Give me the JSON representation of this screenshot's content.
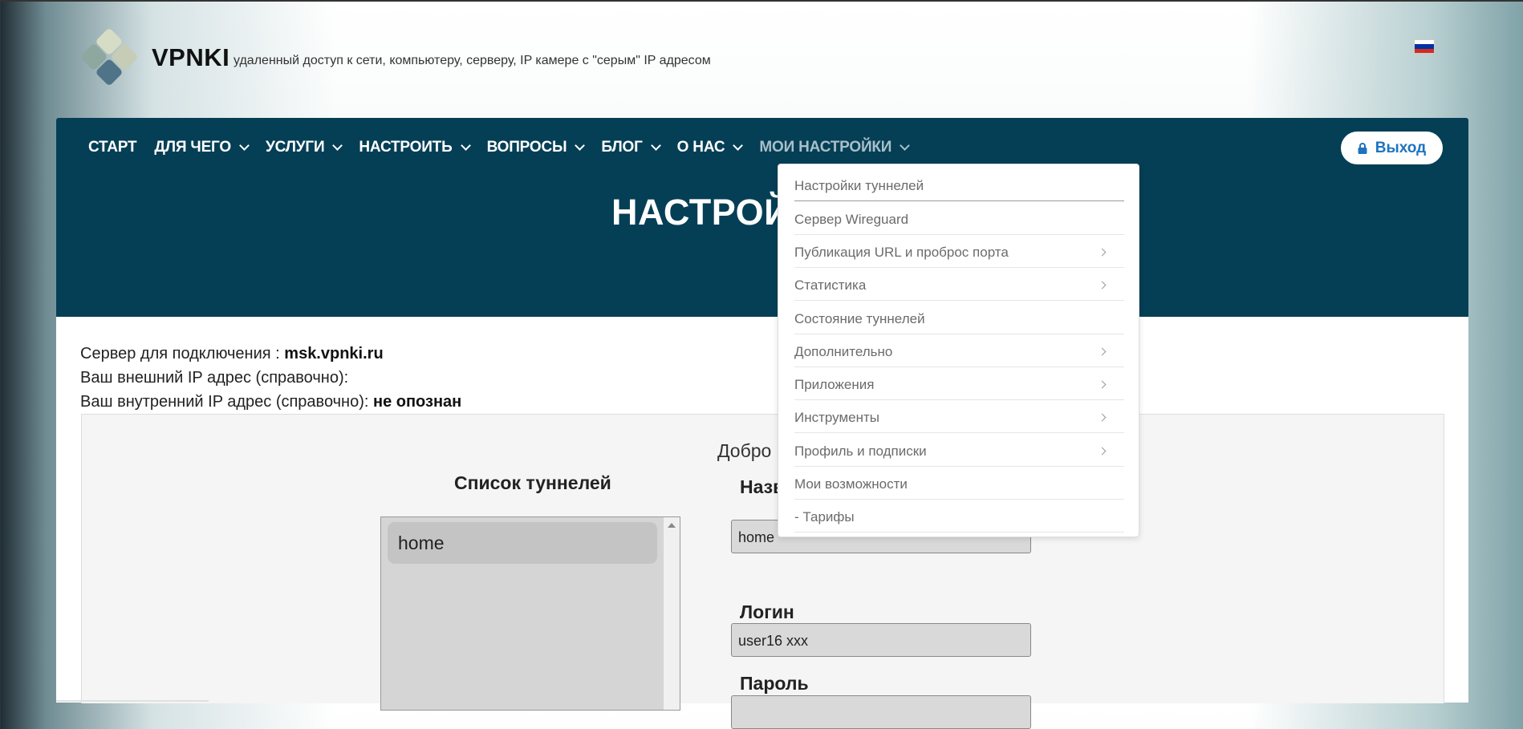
{
  "header": {
    "brand": "VPNKI",
    "tagline": "удаленный доступ к сети, компьютеру, серверу, IP камере с \"серым\" IP адресом",
    "flag_colors": [
      "#ffffff",
      "#0033a0",
      "#d52b1e"
    ]
  },
  "nav": {
    "items": [
      {
        "label": "СТАРТ",
        "has_dropdown": false
      },
      {
        "label": "ДЛЯ ЧЕГО",
        "has_dropdown": true
      },
      {
        "label": "УСЛУГИ",
        "has_dropdown": true
      },
      {
        "label": "НАСТРОИТЬ",
        "has_dropdown": true
      },
      {
        "label": "ВОПРОСЫ",
        "has_dropdown": true
      },
      {
        "label": "БЛОГ",
        "has_dropdown": true
      },
      {
        "label": "О НАС",
        "has_dropdown": true
      },
      {
        "label": "МОИ НАСТРОЙКИ",
        "has_dropdown": true
      }
    ],
    "logout_label": "Выход"
  },
  "hero": {
    "title": "НАСТРОЙКИ"
  },
  "dropdown": {
    "items": [
      {
        "label": "Настройки туннелей",
        "submenu": false
      },
      {
        "label": "Сервер Wireguard",
        "submenu": false
      },
      {
        "label": "Публикация URL и проброс порта",
        "submenu": true
      },
      {
        "label": "Статистика",
        "submenu": true
      },
      {
        "label": "Состояние туннелей",
        "submenu": false
      },
      {
        "label": "Дополнительно",
        "submenu": true
      },
      {
        "label": "Приложения",
        "submenu": true
      },
      {
        "label": "Инструменты",
        "submenu": true
      },
      {
        "label": "Профиль и подписки",
        "submenu": true
      },
      {
        "label": "Мои возможности",
        "submenu": false
      },
      {
        "label": "- Тарифы",
        "submenu": false
      }
    ]
  },
  "info": {
    "server_label": "Сервер для подключения : ",
    "server_value": "msk.vpnki.ru",
    "external_ip_label": "Ваш внешний IP адрес (справочно):",
    "internal_ip_label": "Ваш внутренний IP адрес (справочно): ",
    "internal_ip_value": "не опознан"
  },
  "panel": {
    "welcome": "Добро пожаловать, поль",
    "tunnel_list_title": "Список туннелей",
    "tunnels": [
      "home"
    ],
    "name_label": "Назв",
    "name_value": "home",
    "login_label": "Логин",
    "login_value": "user16 xxx",
    "password_label": "Пароль"
  },
  "colors": {
    "navbar": "#053f56",
    "accent": "#1e73be"
  }
}
